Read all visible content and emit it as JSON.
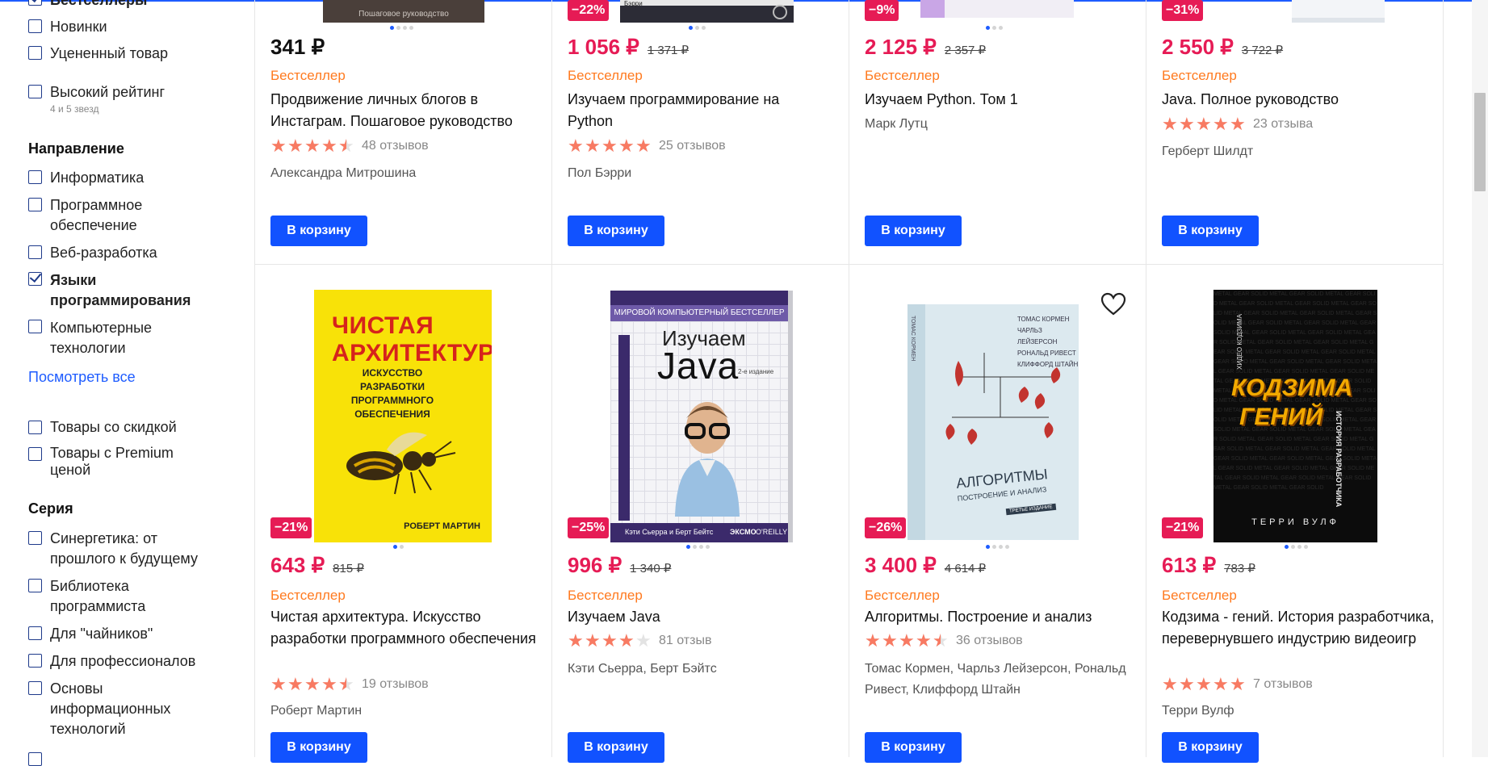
{
  "sidebar": {
    "top_partial": "Бестселлеры",
    "group1": [
      {
        "label": "Новинки",
        "checked": false
      },
      {
        "label": "Уцененный товар",
        "checked": false
      }
    ],
    "high_rating": {
      "label": "Высокий рейтинг",
      "sub": "4 и 5 звезд",
      "checked": false
    },
    "direction": {
      "title": "Направление",
      "items": [
        {
          "label": "Информатика",
          "checked": false
        },
        {
          "label": "Программное обеспечение",
          "checked": false
        },
        {
          "label": "Веб-разработка",
          "checked": false
        },
        {
          "label": "Языки программирования",
          "checked": true
        },
        {
          "label": "Компьютерные технологии",
          "checked": false
        }
      ],
      "see_all": "Посмотреть все"
    },
    "extras": [
      {
        "label": "Товары со скидкой",
        "checked": false
      },
      {
        "label": "Товары с Premium ценой",
        "checked": false
      }
    ],
    "series": {
      "title": "Серия",
      "items": [
        {
          "label": "Синергетика: от прошлого к будущему",
          "checked": false
        },
        {
          "label": "Библиотека программиста",
          "checked": false
        },
        {
          "label": "Для \"чайников\"",
          "checked": false
        },
        {
          "label": "Для профессионалов",
          "checked": false
        },
        {
          "label": "Основы информационных технологий",
          "checked": false
        }
      ]
    }
  },
  "currency": "₽",
  "cart_button": "В корзину",
  "products_row1": [
    {
      "price": "341 ₽",
      "old_price": "",
      "discount": "",
      "tag": "Бестселлер",
      "title": "Продвижение личных блогов в Инстаграм. Пошаговое руководство",
      "rating": 4.5,
      "reviews": "48 отзывов",
      "author": "Александра Митрошина",
      "cover_text": "Пошаговое руководство"
    },
    {
      "price": "1 056 ₽",
      "old_price": "1 371 ₽",
      "discount": "−22%",
      "tag": "Бестселлер",
      "title": "Изучаем программирование на Python",
      "rating": 5,
      "reviews": "25 отзывов",
      "author": "Пол Бэрри",
      "cover_text": "Бэрри"
    },
    {
      "price": "2 125 ₽",
      "old_price": "2 357 ₽",
      "discount": "−9%",
      "tag": "Бестселлер",
      "title": "Изучаем Python. Том 1",
      "rating": null,
      "reviews": "",
      "author": "Марк Лутц",
      "cover_text": ""
    },
    {
      "price": "2 550 ₽",
      "old_price": "3 722 ₽",
      "discount": "−31%",
      "tag": "Бестселлер",
      "title": "Java. Полное руководство",
      "rating": 5,
      "reviews": "23 отзыва",
      "author": "Герберт Шилдт",
      "cover_text": ""
    }
  ],
  "products_row2": [
    {
      "price": "643 ₽",
      "old_price": "815 ₽",
      "discount": "−21%",
      "tag": "Бестселлер",
      "title": "Чистая архитектура. Искусство разработки программного обеспечения",
      "rating": 4.5,
      "reviews": "19 отзывов",
      "author": "Роберт Мартин",
      "cover": {
        "t1": "ЧИСТАЯ",
        "t2": "АРХИТЕКТУРА",
        "sub1": "ИСКУССТВО РАЗРАБОТКИ",
        "sub2": "ПРОГРАММНОГО",
        "sub3": "ОБЕСПЕЧЕНИЯ",
        "author": "РОБЕРТ МАРТИН"
      }
    },
    {
      "price": "996 ₽",
      "old_price": "1 340 ₽",
      "discount": "−25%",
      "tag": "Бестселлер",
      "title": "Изучаем Java",
      "rating": 4,
      "reviews": "81 отзыв",
      "author": "Кэти Сьерра, Берт Бэйтс",
      "cover": {
        "top": "МИРОВОЙ КОМПЬЮТЕРНЫЙ БЕСТСЕЛЛЕР",
        "t1": "Изучаем",
        "t2": "Java",
        "ed": "2-е издание",
        "authors": "Кэти Сьерра и Берт Бейтс",
        "pub1": "ЭКСМО",
        "pub2": "O'REILLY"
      }
    },
    {
      "price": "3 400 ₽",
      "old_price": "4 614 ₽",
      "discount": "−26%",
      "tag": "Бестселлер",
      "title": "Алгоритмы. Построение и анализ",
      "rating": 4.5,
      "reviews": "36 отзывов",
      "author": "Томас Кормен, Чарльз Лейзерсон, Рональд Ривест, Клиффорд Штайн",
      "cover": {
        "a1": "ТОМАС КОРМЕН",
        "a2": "ЧАРЛЬЗ ЛЕЙЗЕРСОН",
        "a3": "РОНАЛЬД РИВЕСТ",
        "a4": "КЛИФФОРД ШТАЙН",
        "t1": "АЛГОРИТМЫ",
        "t2": "ПОСТРОЕНИЕ И АНАЛИЗ",
        "ed": "ТРЕТЬЕ ИЗДАНИЕ",
        "spine": "ТОМАС КОРМЕН"
      }
    },
    {
      "price": "613 ₽",
      "old_price": "783 ₽",
      "discount": "−21%",
      "tag": "Бестселлер",
      "title": "Кодзима - гений. История разработчика, перевернувшего индустрию видеоигр",
      "rating": 5,
      "reviews": "7 отзывов",
      "author": "Терри Вулф",
      "cover": {
        "t1": "КОДЗИМА",
        "t2": "ГЕНИЙ",
        "side1": "ХИДЕО КОДЗИМА",
        "side2": "ИСТОРИЯ РАЗРАБОТЧИКА",
        "author": "ТЕРРИ ВУЛФ",
        "bg": "METAL GEAR SOLID"
      }
    }
  ],
  "colors": {
    "accent": "#1152ff",
    "sale": "#e61b55",
    "bestseller": "#ff7a1f",
    "star": "#f87a62"
  }
}
